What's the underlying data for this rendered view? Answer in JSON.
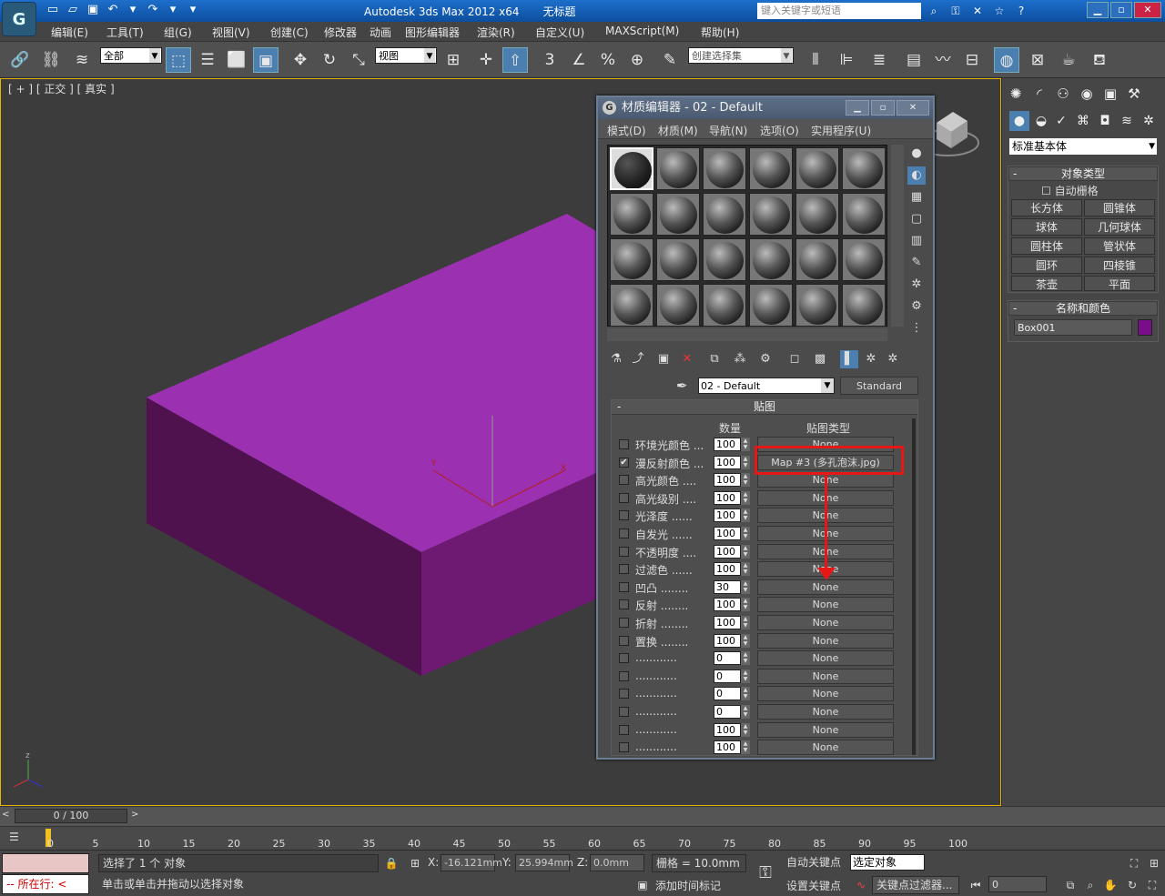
{
  "app": {
    "title": "Autodesk 3ds Max  2012 x64",
    "doc_name": "无标题",
    "search_placeholder": "键入关键字或短语",
    "logo_glyph": "G"
  },
  "menu": [
    "编辑(E)",
    "工具(T)",
    "组(G)",
    "视图(V)",
    "创建(C)",
    "修改器",
    "动画",
    "图形编辑器",
    "渲染(R)",
    "自定义(U)",
    "MAXScript(M)",
    "帮助(H)"
  ],
  "toolbar": {
    "filter_value": "全部",
    "refcoord_value": "视图",
    "selection_set_placeholder": "创建选择集",
    "snap_labels": [
      "3",
      "%"
    ]
  },
  "viewport": {
    "label": "[ + ] [ 正交 ] [ 真实 ]",
    "box_color": "#9b30b0"
  },
  "command_panel": {
    "category": "标准基本体",
    "object_type_title": "对象类型",
    "autogrid_label": "自动栅格",
    "buttons": [
      "长方体",
      "圆锥体",
      "球体",
      "几何球体",
      "圆柱体",
      "管状体",
      "圆环",
      "四棱锥",
      "茶壶",
      "平面"
    ],
    "name_color_title": "名称和颜色",
    "object_name": "Box001",
    "object_color": "#7a0e8a"
  },
  "material_editor": {
    "title": "材质编辑器 - 02 - Default",
    "menu": [
      "模式(D)",
      "材质(M)",
      "导航(N)",
      "选项(O)",
      "实用程序(U)"
    ],
    "material_name": "02 - Default",
    "material_type": "Standard",
    "maps_title": "贴图",
    "col_amount": "数量",
    "col_map_type": "贴图类型",
    "map_rows": [
      {
        "label": "环境光颜色 ...",
        "checked": false,
        "amount": "100",
        "map": "None"
      },
      {
        "label": "漫反射颜色 ...",
        "checked": true,
        "amount": "100",
        "map": "Map #3 (多孔泡沫.jpg)"
      },
      {
        "label": "高光颜色 ....",
        "checked": false,
        "amount": "100",
        "map": "None"
      },
      {
        "label": "高光级别 ....",
        "checked": false,
        "amount": "100",
        "map": "None"
      },
      {
        "label": "光泽度 ......",
        "checked": false,
        "amount": "100",
        "map": "None"
      },
      {
        "label": "自发光 ......",
        "checked": false,
        "amount": "100",
        "map": "None"
      },
      {
        "label": "不透明度 ....",
        "checked": false,
        "amount": "100",
        "map": "None"
      },
      {
        "label": "过滤色 ......",
        "checked": false,
        "amount": "100",
        "map": "None"
      },
      {
        "label": "凹凸 ........",
        "checked": false,
        "amount": "30",
        "map": "None"
      },
      {
        "label": "反射 ........",
        "checked": false,
        "amount": "100",
        "map": "None"
      },
      {
        "label": "折射 ........",
        "checked": false,
        "amount": "100",
        "map": "None"
      },
      {
        "label": "置换 ........",
        "checked": false,
        "amount": "100",
        "map": "None"
      },
      {
        "label": "............",
        "checked": false,
        "amount": "0",
        "map": "None"
      },
      {
        "label": "............",
        "checked": false,
        "amount": "0",
        "map": "None"
      },
      {
        "label": "............",
        "checked": false,
        "amount": "0",
        "map": "None"
      },
      {
        "label": "............",
        "checked": false,
        "amount": "0",
        "map": "None"
      },
      {
        "label": "............",
        "checked": false,
        "amount": "100",
        "map": "None"
      },
      {
        "label": "............",
        "checked": false,
        "amount": "100",
        "map": "None"
      }
    ]
  },
  "timeline": {
    "frame_display": "0 / 100",
    "ticks": [
      "0",
      "5",
      "10",
      "15",
      "20",
      "25",
      "30",
      "35",
      "40",
      "45",
      "50",
      "55",
      "60",
      "65",
      "70",
      "75",
      "80",
      "85",
      "90",
      "95",
      "100"
    ]
  },
  "status": {
    "running_label": "所在行:",
    "selected_text": "选择了 1 个 对象",
    "prompt_text": "单击或单击并拖动以选择对象",
    "x_label": "X:",
    "x_value": "-16.121mm",
    "y_label": "Y:",
    "y_value": "25.994mm",
    "z_label": "Z:",
    "z_value": "0.0mm",
    "grid_text": "栅格 = 10.0mm",
    "time_tag": "添加时间标记",
    "auto_key": "自动关键点",
    "selected_obj": "选定对象",
    "set_key": "设置关键点",
    "key_filters": "关键点过滤器...",
    "frame_value": "0"
  }
}
